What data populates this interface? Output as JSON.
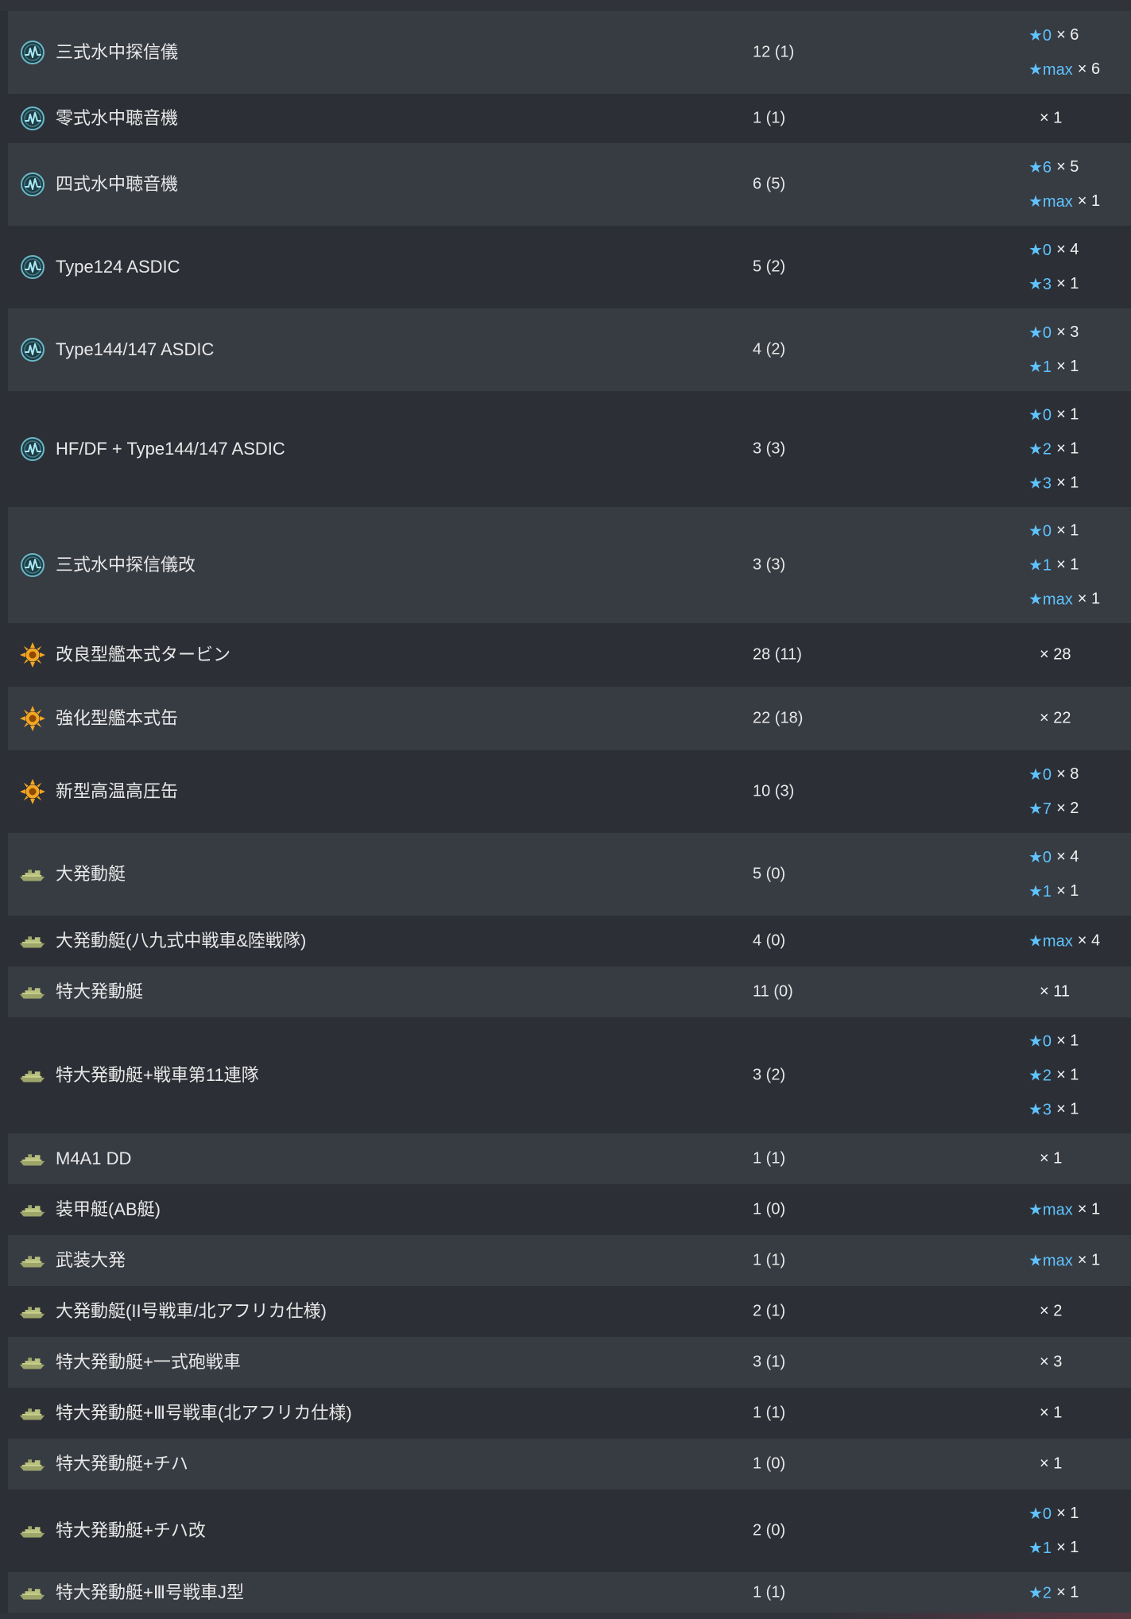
{
  "rows": [
    {
      "icon": "sonar-icon",
      "name": "三式水中探信儀",
      "count": "12 (1)",
      "improvements": [
        {
          "level": "★0",
          "count": "× 6"
        },
        {
          "level": "★max",
          "count": "× 6"
        }
      ]
    },
    {
      "icon": "sonar-icon",
      "name": "零式水中聴音機",
      "count": "1 (1)",
      "improvements": [
        {
          "level": "",
          "count": "× 1"
        }
      ]
    },
    {
      "icon": "sonar-icon",
      "name": "四式水中聴音機",
      "count": "6 (5)",
      "improvements": [
        {
          "level": "★6",
          "count": "× 5"
        },
        {
          "level": "★max",
          "count": "× 1"
        }
      ]
    },
    {
      "icon": "sonar-icon",
      "name": "Type124 ASDIC",
      "count": "5 (2)",
      "improvements": [
        {
          "level": "★0",
          "count": "× 4"
        },
        {
          "level": "★3",
          "count": "× 1"
        }
      ]
    },
    {
      "icon": "sonar-icon",
      "name": "Type144/147 ASDIC",
      "count": "4 (2)",
      "improvements": [
        {
          "level": "★0",
          "count": "× 3"
        },
        {
          "level": "★1",
          "count": "× 1"
        }
      ]
    },
    {
      "icon": "sonar-icon",
      "name": "HF/DF + Type144/147 ASDIC",
      "count": "3 (3)",
      "improvements": [
        {
          "level": "★0",
          "count": "× 1"
        },
        {
          "level": "★2",
          "count": "× 1"
        },
        {
          "level": "★3",
          "count": "× 1"
        }
      ]
    },
    {
      "icon": "sonar-icon",
      "name": "三式水中探信儀改",
      "count": "3 (3)",
      "improvements": [
        {
          "level": "★0",
          "count": "× 1"
        },
        {
          "level": "★1",
          "count": "× 1"
        },
        {
          "level": "★max",
          "count": "× 1"
        }
      ]
    },
    {
      "icon": "turbine-icon",
      "name": "改良型艦本式タービン",
      "count": "28 (11)",
      "improvements": [
        {
          "level": "",
          "count": "× 28"
        }
      ]
    },
    {
      "icon": "turbine-icon",
      "name": "強化型艦本式缶",
      "count": "22 (18)",
      "improvements": [
        {
          "level": "",
          "count": "× 22"
        }
      ]
    },
    {
      "icon": "turbine-icon",
      "name": "新型高温高圧缶",
      "count": "10 (3)",
      "improvements": [
        {
          "level": "★0",
          "count": "× 8"
        },
        {
          "level": "★7",
          "count": "× 2"
        }
      ]
    },
    {
      "icon": "landing-craft-icon",
      "name": "大発動艇",
      "count": "5 (0)",
      "improvements": [
        {
          "level": "★0",
          "count": "× 4"
        },
        {
          "level": "★1",
          "count": "× 1"
        }
      ]
    },
    {
      "icon": "landing-craft-icon",
      "name": "大発動艇(八九式中戦車&陸戦隊)",
      "count": "4 (0)",
      "improvements": [
        {
          "level": "★max",
          "count": "× 4"
        }
      ]
    },
    {
      "icon": "landing-craft-icon",
      "name": "特大発動艇",
      "count": "11 (0)",
      "improvements": [
        {
          "level": "",
          "count": "× 11"
        }
      ]
    },
    {
      "icon": "landing-craft-icon",
      "name": "特大発動艇+戦車第11連隊",
      "count": "3 (2)",
      "improvements": [
        {
          "level": "★0",
          "count": "× 1"
        },
        {
          "level": "★2",
          "count": "× 1"
        },
        {
          "level": "★3",
          "count": "× 1"
        }
      ]
    },
    {
      "icon": "landing-craft-icon",
      "name": "M4A1 DD",
      "count": "1 (1)",
      "improvements": [
        {
          "level": "",
          "count": "× 1"
        }
      ]
    },
    {
      "icon": "landing-craft-icon",
      "name": "装甲艇(AB艇)",
      "count": "1 (0)",
      "improvements": [
        {
          "level": "★max",
          "count": "× 1"
        }
      ]
    },
    {
      "icon": "landing-craft-icon",
      "name": "武装大発",
      "count": "1 (1)",
      "improvements": [
        {
          "level": "★max",
          "count": "× 1"
        }
      ]
    },
    {
      "icon": "landing-craft-icon",
      "name": "大発動艇(II号戦車/北アフリカ仕様)",
      "count": "2 (1)",
      "improvements": [
        {
          "level": "",
          "count": "× 2"
        }
      ]
    },
    {
      "icon": "landing-craft-icon",
      "name": "特大発動艇+一式砲戦車",
      "count": "3 (1)",
      "improvements": [
        {
          "level": "",
          "count": "× 3"
        }
      ]
    },
    {
      "icon": "landing-craft-icon",
      "name": "特大発動艇+Ⅲ号戦車(北アフリカ仕様)",
      "count": "1 (1)",
      "improvements": [
        {
          "level": "",
          "count": "× 1"
        }
      ]
    },
    {
      "icon": "landing-craft-icon",
      "name": "特大発動艇+チハ",
      "count": "1 (0)",
      "improvements": [
        {
          "level": "",
          "count": "× 1"
        }
      ]
    },
    {
      "icon": "landing-craft-icon",
      "name": "特大発動艇+チハ改",
      "count": "2 (0)",
      "improvements": [
        {
          "level": "★0",
          "count": "× 1"
        },
        {
          "level": "★1",
          "count": "× 1"
        }
      ]
    },
    {
      "icon": "landing-craft-icon",
      "name": "特大発動艇+Ⅲ号戦車J型",
      "count": "1 (1)",
      "improvements": [
        {
          "level": "★2",
          "count": "× 1"
        }
      ]
    }
  ]
}
